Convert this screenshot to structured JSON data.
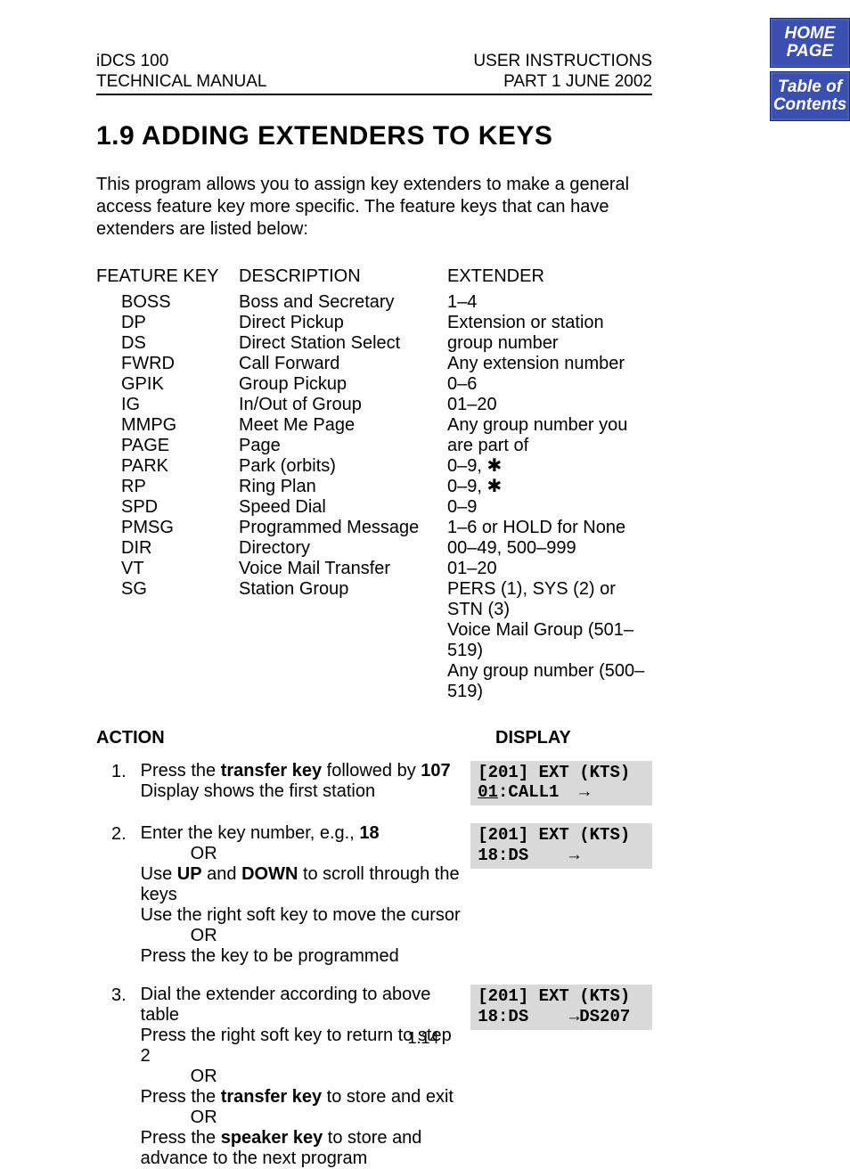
{
  "header": {
    "left1": "iDCS 100",
    "left2": "TECHNICAL MANUAL",
    "right1": "USER INSTRUCTIONS",
    "right2": "PART 1   JUNE  2002"
  },
  "nav": {
    "home_l1": "HOME",
    "home_l2": "PAGE",
    "toc_l1": "Table of",
    "toc_l2": "Contents"
  },
  "title": "1.9 ADDING EXTENDERS TO KEYS",
  "intro": "This program allows you to assign key extenders to make a general access feature key more specific. The feature keys that can have extenders are listed below:",
  "table": {
    "h_fk": "FEATURE KEY",
    "h_desc": "DESCRIPTION",
    "h_ext": "EXTENDER",
    "rows": [
      {
        "fk": "BOSS",
        "desc": "Boss and Secretary",
        "ext": "1–4"
      },
      {
        "fk": "DP",
        "desc": "Direct Pickup",
        "ext": "Extension or station group number"
      },
      {
        "fk": "DS",
        "desc": "Direct Station Select",
        "ext": "Any extension number"
      },
      {
        "fk": "FWRD",
        "desc": "Call Forward",
        "ext": "0–6"
      },
      {
        "fk": "GPIK",
        "desc": "Group Pickup",
        "ext": "01–20"
      },
      {
        "fk": "IG",
        "desc": "In/Out of Group",
        "ext": "Any group number you are part of"
      },
      {
        "fk": "MMPG",
        "desc": "Meet Me Page",
        "ext": "0–9, ✱"
      },
      {
        "fk": "PAGE",
        "desc": "Page",
        "ext": "0–9, ✱"
      },
      {
        "fk": "PARK",
        "desc": "Park (orbits)",
        "ext": "0–9"
      },
      {
        "fk": "RP",
        "desc": "Ring Plan",
        "ext": "1–6 or HOLD for None"
      },
      {
        "fk": "SPD",
        "desc": "Speed Dial",
        "ext": "00–49, 500–999"
      },
      {
        "fk": "PMSG",
        "desc": "Programmed Message",
        "ext": "01–20"
      },
      {
        "fk": "DIR",
        "desc": "Directory",
        "ext": "PERS (1), SYS (2) or STN (3)"
      },
      {
        "fk": "VT",
        "desc": "Voice Mail Transfer",
        "ext": "Voice Mail Group (501–519)"
      },
      {
        "fk": "SG",
        "desc": "Station Group",
        "ext": "Any group number (500–519)"
      }
    ]
  },
  "labels": {
    "action": "ACTION",
    "display": "DISPLAY",
    "or": "OR"
  },
  "steps": [
    {
      "num": "1.",
      "lines": [
        [
          {
            "t": "Press the "
          },
          {
            "t": "transfer key",
            "b": true
          },
          {
            "t": " followed by "
          },
          {
            "t": "107",
            "b": true
          }
        ],
        [
          {
            "t": "Display shows the first station"
          }
        ]
      ],
      "lcd": {
        "l1": "[201] EXT (KTS)",
        "l2a": "01",
        "l2b": ":CALL1  →"
      }
    },
    {
      "num": "2.",
      "lines": [
        [
          {
            "t": "Enter the key number, e.g., "
          },
          {
            "t": "18",
            "b": true
          }
        ],
        "OR",
        [
          {
            "t": "Use "
          },
          {
            "t": "UP",
            "b": true
          },
          {
            "t": " and "
          },
          {
            "t": "DOWN",
            "b": true
          },
          {
            "t": " to scroll through the keys"
          }
        ],
        [
          {
            "t": "Use the right soft key to move the cursor"
          }
        ],
        "OR",
        [
          {
            "t": "Press the key to be programmed"
          }
        ]
      ],
      "lcd": {
        "l1": "[201] EXT (KTS)",
        "l2": "18:DS    →"
      }
    },
    {
      "num": "3.",
      "lines": [
        [
          {
            "t": "Dial the extender according to above table"
          }
        ],
        [
          {
            "t": "Press the right soft key to return to step 2"
          }
        ],
        "OR",
        [
          {
            "t": "Press the "
          },
          {
            "t": "transfer key",
            "b": true
          },
          {
            "t": " to store and exit"
          }
        ],
        "OR",
        [
          {
            "t": "Press the "
          },
          {
            "t": "speaker key",
            "b": true
          },
          {
            "t": " to store and advance to the next program"
          }
        ]
      ],
      "lcd": {
        "l1": "[201] EXT (KTS)",
        "l2": "18:DS    →DS207"
      }
    }
  ],
  "pagenum": "1.14"
}
